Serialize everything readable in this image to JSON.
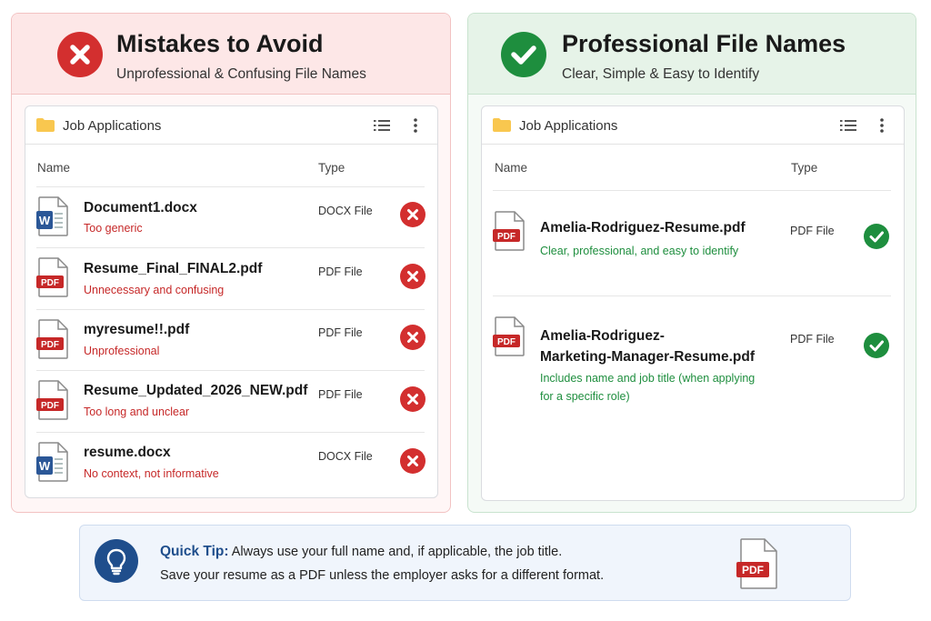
{
  "colors": {
    "bad": "#d32f2f",
    "good": "#1e8e3e",
    "tip_accent": "#1f4e8c"
  },
  "bad_panel": {
    "title": "Mistakes to Avoid",
    "subtitle": "Unprofessional & Confusing File Names",
    "header_icon": "x-circle-icon",
    "explorer": {
      "folder_title": "Job Applications",
      "col_name": "Name",
      "col_type": "Type",
      "files": [
        {
          "name": "Document1.docx",
          "desc": "Too generic",
          "type": "DOCX File",
          "icon": "word-file-icon"
        },
        {
          "name": "Resume_Final_FINAL2.pdf",
          "desc": "Unnecessary and confusing",
          "type": "PDF File",
          "icon": "pdf-file-icon"
        },
        {
          "name": "myresume!!.pdf",
          "desc": "Unprofessional",
          "type": "PDF File",
          "icon": "pdf-file-icon"
        },
        {
          "name": "Resume_Updated_2026_NEW.pdf",
          "desc": "Too long and unclear",
          "type": "PDF File",
          "icon": "pdf-file-icon"
        },
        {
          "name": "resume.docx",
          "desc": "No context, not informative",
          "type": "DOCX File",
          "icon": "word-file-icon"
        }
      ]
    }
  },
  "good_panel": {
    "title": "Professional File Names",
    "subtitle": "Clear, Simple & Easy to Identify",
    "header_icon": "check-circle-icon",
    "explorer": {
      "folder_title": "Job Applications",
      "col_name": "Name",
      "col_type": "Type",
      "files": [
        {
          "name_line1": "Amelia-Rodriguez-Resume.pdf",
          "desc_line1": "Clear, professional, and easy to identify",
          "type": "PDF File",
          "icon": "pdf-file-icon"
        },
        {
          "name_line1": "Amelia-Rodriguez-",
          "name_line2": "Marketing-Manager-Resume.pdf",
          "desc_line1": "Includes name and job title (when applying",
          "desc_line2": "for a specific role)",
          "type": "PDF File",
          "icon": "pdf-file-icon"
        }
      ]
    }
  },
  "pdf_badge": "PDF",
  "word_badge": "W",
  "tip": {
    "label": "Quick Tip:",
    "line1": " Always use your full name and, if applicable, the job title.",
    "line2": "Save your resume as a PDF unless the employer asks for a different format.",
    "icon": "lightbulb-icon"
  }
}
